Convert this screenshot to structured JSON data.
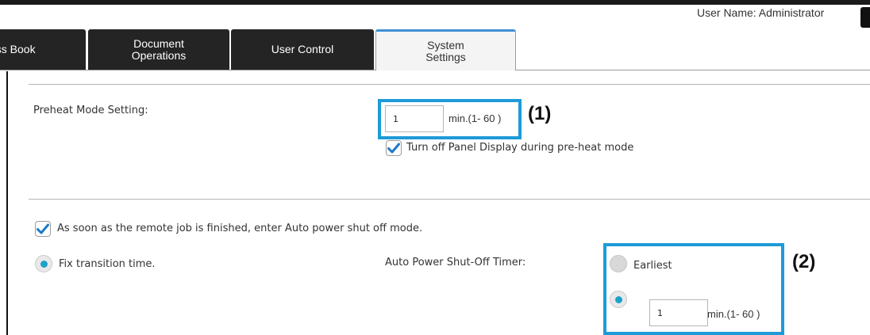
{
  "header": {
    "user_name_label": "User Name: Administrator"
  },
  "tabs": [
    {
      "line1": "ess Book",
      "line2": "",
      "active": false
    },
    {
      "line1": "Document",
      "line2": "Operations",
      "active": false
    },
    {
      "line1": "User Control",
      "line2": "",
      "active": false
    },
    {
      "line1": "System",
      "line2": "Settings",
      "active": true
    }
  ],
  "preheat": {
    "label": "Preheat Mode Setting:",
    "value": "1",
    "range_text": "min.(1- 60 )",
    "callout": "(1)",
    "panel_off_label": "Turn off Panel Display during pre-heat mode",
    "panel_off_checked": true
  },
  "auto_power": {
    "remote_job_label": "As soon as the remote job is finished, enter Auto power shut off mode.",
    "remote_job_checked": true,
    "fix_transition_label": "Fix transition time.",
    "fix_transition_selected": true,
    "timer_label": "Auto Power Shut-Off Timer:",
    "earliest_label": "Earliest",
    "earliest_selected": false,
    "custom_selected": true,
    "value": "1",
    "range_text": "min.(1- 60 )",
    "callout": "(2)"
  },
  "colors": {
    "highlight": "#1e9bd7",
    "accent": "#1ea1c9",
    "tab_dark": "#242424",
    "tab_active_border": "#3f8fd4"
  }
}
